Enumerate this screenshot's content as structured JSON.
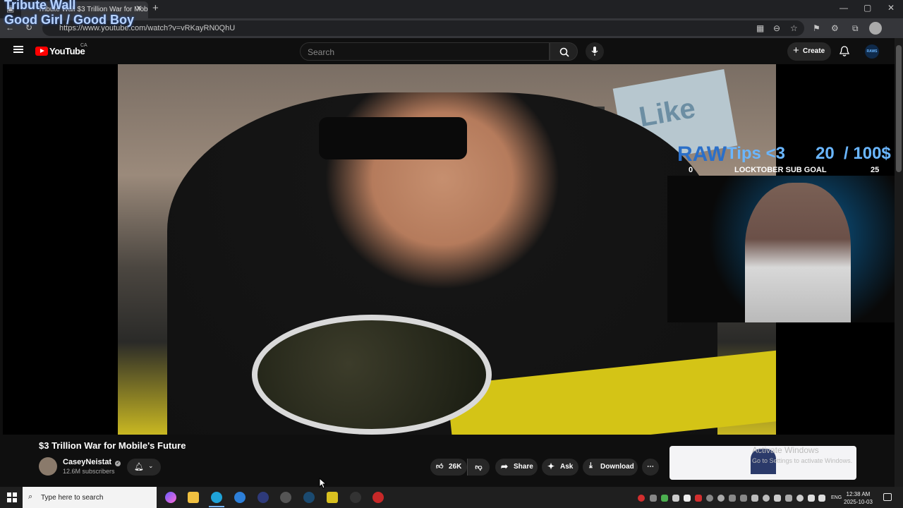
{
  "browser": {
    "tab_title": "Tribute Wall $3 Trillion War for Mobile's F",
    "url": "https://www.youtube.com/watch?v=vRKayRN0QhU"
  },
  "overlay_text": {
    "line1": "Tribute Wall",
    "line2": "Good Girl / Good Boy"
  },
  "youtube": {
    "logo": "YouTube",
    "region": "CA",
    "search_placeholder": "Search",
    "create_label": "Create",
    "avatar_text": "RAWS"
  },
  "stream_overlay": {
    "raw": "RAW",
    "tips": "Tips <3",
    "goal_current": "20",
    "goal_target": "/ 100$",
    "sub_goal_start": "0",
    "sub_goal_label": "LOCKTOBER SUB GOAL",
    "sub_goal_end": "25"
  },
  "video": {
    "title": "$3 Trillion War for Mobile's Future",
    "channel": "CaseyNeistat",
    "subscribers": "12.6M subscribers",
    "likes": "26K",
    "share_label": "Share",
    "ask_label": "Ask",
    "download_label": "Download",
    "sign_text": "Like"
  },
  "watermark": {
    "title": "Activate Windows",
    "subtitle": "Go to Settings to activate Windows."
  },
  "taskbar": {
    "search_placeholder": "Type here to search",
    "lang": "ENG",
    "time": "12:38 AM",
    "date": "2025-10-03"
  },
  "colors": {
    "youtube_red": "#ff0000",
    "overlay_blue": "#6ab6ff"
  }
}
